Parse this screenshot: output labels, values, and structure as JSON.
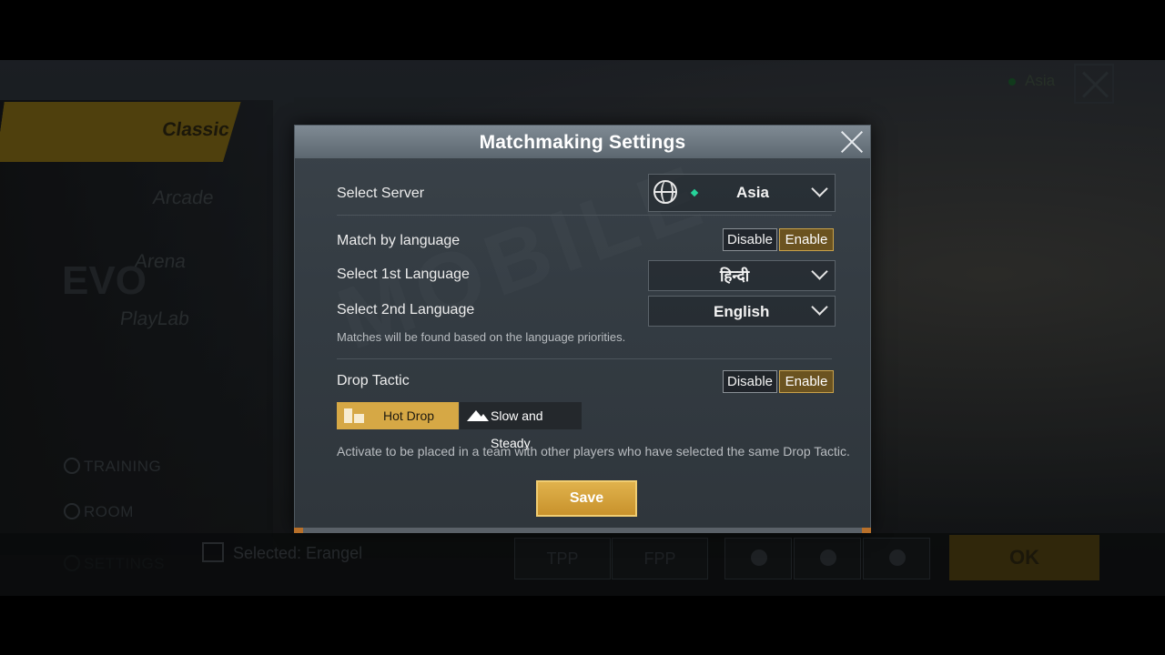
{
  "background": {
    "modes": [
      "Classic",
      "Arcade",
      "Arena",
      "PlayLab"
    ],
    "evo_label": "EVO",
    "side_links": [
      "TRAINING",
      "ROOM",
      "SETTINGS"
    ],
    "region": "Asia",
    "selected_map": "Selected: Erangel",
    "perspective": [
      "TPP",
      "FPP"
    ],
    "ok_label": "OK"
  },
  "dialog": {
    "title": "Matchmaking Settings",
    "watermark": "MOBILE",
    "server": {
      "label": "Select Server",
      "value": "Asia"
    },
    "match_language": {
      "label": "Match by language",
      "disable": "Disable",
      "enable": "Enable",
      "selected": "Enable"
    },
    "first_language": {
      "label": "Select 1st Language",
      "value": "हिन्दी"
    },
    "second_language": {
      "label": "Select 2nd Language",
      "value": "English"
    },
    "language_note": "Matches will be found based on the language priorities.",
    "drop_tactic": {
      "label": "Drop Tactic",
      "disable": "Disable",
      "enable": "Enable",
      "selected": "Enable",
      "options": [
        "Hot Drop",
        "Slow and Steady"
      ],
      "active_option": "Hot Drop",
      "note": "Activate to be placed in a team with other players who have selected the same Drop Tactic."
    },
    "save_label": "Save"
  },
  "colors": {
    "accent": "#d6a845",
    "server_status": "#26d39a"
  }
}
